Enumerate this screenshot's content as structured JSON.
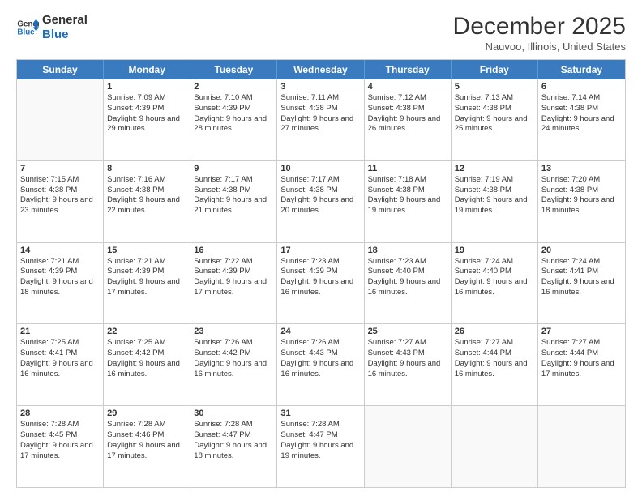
{
  "logo": {
    "line1": "General",
    "line2": "Blue"
  },
  "title": "December 2025",
  "location": "Nauvoo, Illinois, United States",
  "header_days": [
    "Sunday",
    "Monday",
    "Tuesday",
    "Wednesday",
    "Thursday",
    "Friday",
    "Saturday"
  ],
  "weeks": [
    [
      {
        "day": "",
        "sunrise": "",
        "sunset": "",
        "daylight": ""
      },
      {
        "day": "1",
        "sunrise": "Sunrise: 7:09 AM",
        "sunset": "Sunset: 4:39 PM",
        "daylight": "Daylight: 9 hours and 29 minutes."
      },
      {
        "day": "2",
        "sunrise": "Sunrise: 7:10 AM",
        "sunset": "Sunset: 4:39 PM",
        "daylight": "Daylight: 9 hours and 28 minutes."
      },
      {
        "day": "3",
        "sunrise": "Sunrise: 7:11 AM",
        "sunset": "Sunset: 4:38 PM",
        "daylight": "Daylight: 9 hours and 27 minutes."
      },
      {
        "day": "4",
        "sunrise": "Sunrise: 7:12 AM",
        "sunset": "Sunset: 4:38 PM",
        "daylight": "Daylight: 9 hours and 26 minutes."
      },
      {
        "day": "5",
        "sunrise": "Sunrise: 7:13 AM",
        "sunset": "Sunset: 4:38 PM",
        "daylight": "Daylight: 9 hours and 25 minutes."
      },
      {
        "day": "6",
        "sunrise": "Sunrise: 7:14 AM",
        "sunset": "Sunset: 4:38 PM",
        "daylight": "Daylight: 9 hours and 24 minutes."
      }
    ],
    [
      {
        "day": "7",
        "sunrise": "Sunrise: 7:15 AM",
        "sunset": "Sunset: 4:38 PM",
        "daylight": "Daylight: 9 hours and 23 minutes."
      },
      {
        "day": "8",
        "sunrise": "Sunrise: 7:16 AM",
        "sunset": "Sunset: 4:38 PM",
        "daylight": "Daylight: 9 hours and 22 minutes."
      },
      {
        "day": "9",
        "sunrise": "Sunrise: 7:17 AM",
        "sunset": "Sunset: 4:38 PM",
        "daylight": "Daylight: 9 hours and 21 minutes."
      },
      {
        "day": "10",
        "sunrise": "Sunrise: 7:17 AM",
        "sunset": "Sunset: 4:38 PM",
        "daylight": "Daylight: 9 hours and 20 minutes."
      },
      {
        "day": "11",
        "sunrise": "Sunrise: 7:18 AM",
        "sunset": "Sunset: 4:38 PM",
        "daylight": "Daylight: 9 hours and 19 minutes."
      },
      {
        "day": "12",
        "sunrise": "Sunrise: 7:19 AM",
        "sunset": "Sunset: 4:38 PM",
        "daylight": "Daylight: 9 hours and 19 minutes."
      },
      {
        "day": "13",
        "sunrise": "Sunrise: 7:20 AM",
        "sunset": "Sunset: 4:38 PM",
        "daylight": "Daylight: 9 hours and 18 minutes."
      }
    ],
    [
      {
        "day": "14",
        "sunrise": "Sunrise: 7:21 AM",
        "sunset": "Sunset: 4:39 PM",
        "daylight": "Daylight: 9 hours and 18 minutes."
      },
      {
        "day": "15",
        "sunrise": "Sunrise: 7:21 AM",
        "sunset": "Sunset: 4:39 PM",
        "daylight": "Daylight: 9 hours and 17 minutes."
      },
      {
        "day": "16",
        "sunrise": "Sunrise: 7:22 AM",
        "sunset": "Sunset: 4:39 PM",
        "daylight": "Daylight: 9 hours and 17 minutes."
      },
      {
        "day": "17",
        "sunrise": "Sunrise: 7:23 AM",
        "sunset": "Sunset: 4:39 PM",
        "daylight": "Daylight: 9 hours and 16 minutes."
      },
      {
        "day": "18",
        "sunrise": "Sunrise: 7:23 AM",
        "sunset": "Sunset: 4:40 PM",
        "daylight": "Daylight: 9 hours and 16 minutes."
      },
      {
        "day": "19",
        "sunrise": "Sunrise: 7:24 AM",
        "sunset": "Sunset: 4:40 PM",
        "daylight": "Daylight: 9 hours and 16 minutes."
      },
      {
        "day": "20",
        "sunrise": "Sunrise: 7:24 AM",
        "sunset": "Sunset: 4:41 PM",
        "daylight": "Daylight: 9 hours and 16 minutes."
      }
    ],
    [
      {
        "day": "21",
        "sunrise": "Sunrise: 7:25 AM",
        "sunset": "Sunset: 4:41 PM",
        "daylight": "Daylight: 9 hours and 16 minutes."
      },
      {
        "day": "22",
        "sunrise": "Sunrise: 7:25 AM",
        "sunset": "Sunset: 4:42 PM",
        "daylight": "Daylight: 9 hours and 16 minutes."
      },
      {
        "day": "23",
        "sunrise": "Sunrise: 7:26 AM",
        "sunset": "Sunset: 4:42 PM",
        "daylight": "Daylight: 9 hours and 16 minutes."
      },
      {
        "day": "24",
        "sunrise": "Sunrise: 7:26 AM",
        "sunset": "Sunset: 4:43 PM",
        "daylight": "Daylight: 9 hours and 16 minutes."
      },
      {
        "day": "25",
        "sunrise": "Sunrise: 7:27 AM",
        "sunset": "Sunset: 4:43 PM",
        "daylight": "Daylight: 9 hours and 16 minutes."
      },
      {
        "day": "26",
        "sunrise": "Sunrise: 7:27 AM",
        "sunset": "Sunset: 4:44 PM",
        "daylight": "Daylight: 9 hours and 16 minutes."
      },
      {
        "day": "27",
        "sunrise": "Sunrise: 7:27 AM",
        "sunset": "Sunset: 4:44 PM",
        "daylight": "Daylight: 9 hours and 17 minutes."
      }
    ],
    [
      {
        "day": "28",
        "sunrise": "Sunrise: 7:28 AM",
        "sunset": "Sunset: 4:45 PM",
        "daylight": "Daylight: 9 hours and 17 minutes."
      },
      {
        "day": "29",
        "sunrise": "Sunrise: 7:28 AM",
        "sunset": "Sunset: 4:46 PM",
        "daylight": "Daylight: 9 hours and 17 minutes."
      },
      {
        "day": "30",
        "sunrise": "Sunrise: 7:28 AM",
        "sunset": "Sunset: 4:47 PM",
        "daylight": "Daylight: 9 hours and 18 minutes."
      },
      {
        "day": "31",
        "sunrise": "Sunrise: 7:28 AM",
        "sunset": "Sunset: 4:47 PM",
        "daylight": "Daylight: 9 hours and 19 minutes."
      },
      {
        "day": "",
        "sunrise": "",
        "sunset": "",
        "daylight": ""
      },
      {
        "day": "",
        "sunrise": "",
        "sunset": "",
        "daylight": ""
      },
      {
        "day": "",
        "sunrise": "",
        "sunset": "",
        "daylight": ""
      }
    ]
  ]
}
